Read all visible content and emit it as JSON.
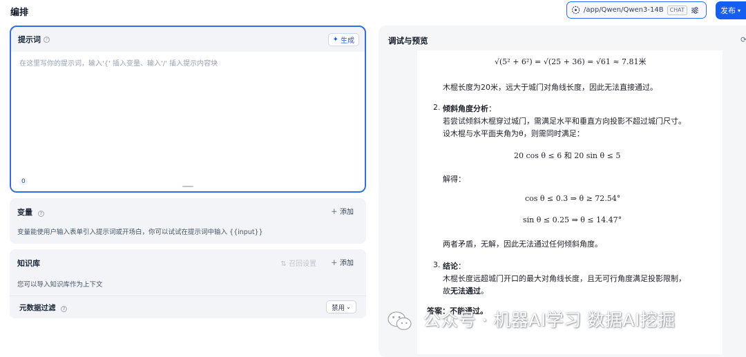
{
  "header": {
    "title": "编排",
    "model_path": "/app/Qwen/Qwen3-14B",
    "model_badge": "CHAT",
    "publish_label": "发布"
  },
  "prompt": {
    "title": "提示词",
    "generate_label": "生成",
    "placeholder": "在这里写你的提示词，输入'{' 插入变量、输入'/' 插入提示内容块",
    "char_count": "0"
  },
  "variables": {
    "title": "变量",
    "add_label": "添加",
    "description": "变量能使用户输入表单引入提示词或开场白，你可以试试在提示词中输入 {{input}}"
  },
  "knowledge": {
    "title": "知识库",
    "recall_label": "召回设置",
    "add_label": "添加",
    "description": "您可以导入知识库作为上下文",
    "metadata_filter_label": "元数据过滤",
    "metadata_filter_value": "禁用"
  },
  "preview": {
    "title": "调试与预览",
    "eq1": "√(5² + 6²) = √(25 + 36) = √61 ≈ 7.81米",
    "line1": "木棍长度为20米，远大于城门对角线长度，因此无法直接通过。",
    "item2_num": "2.",
    "item2_title": "倾斜角度分析",
    "item2_colon": "：",
    "item2_l1": "若尝试倾斜木棍穿过城门，需满足水平和垂直方向投影不超过城门尺寸。",
    "item2_l2": "设木棍与水平面夹角为θ，则需同时满足：",
    "eq2": "20 cos θ ≤ 6    和    20 sin θ ≤ 5",
    "solve_label": "解得：",
    "eq3": "cos θ ≤ 0.3 ⇒ θ ≥ 72.54°",
    "eq4": "sin θ ≤ 0.25 ⇒ θ ≤ 14.47°",
    "contradiction": "两者矛盾，无解，因此无法通过任何倾斜角度。",
    "item3_num": "3.",
    "item3_title": "结论",
    "item3_colon": "：",
    "item3_l1": "木棍长度远超城门开口的最大对角线长度，且无可行角度满足投影限制，",
    "item3_l2_prefix": "故",
    "item3_l2_bold": "无法通过",
    "item3_l2_suffix": "。",
    "answer_label": "答案",
    "answer_text": "：不能通过。"
  },
  "watermark": {
    "text": "公众号 · 机器AI学习 数据AI挖掘"
  },
  "colors": {
    "accent": "#155eef",
    "focus_border": "#2e6bf0",
    "card_bg": "#f2f4f7"
  }
}
